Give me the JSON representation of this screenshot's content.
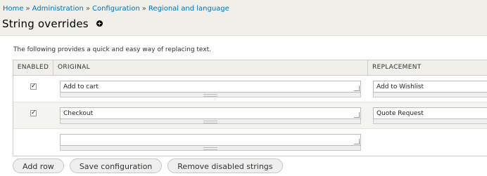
{
  "breadcrumb": {
    "items": [
      "Home",
      "Administration",
      "Configuration",
      "Regional and language"
    ],
    "separator": "»"
  },
  "page": {
    "title": "String overrides",
    "title_icon": "plus-circle-icon",
    "intro": "The following provides a quick and easy way of replacing text."
  },
  "table": {
    "headers": {
      "enabled": "ENABLED",
      "original": "ORIGINAL",
      "replacement": "REPLACEMENT"
    },
    "rows": [
      {
        "enabled": true,
        "original": "Add to cart",
        "replacement": "Add to Wishlist"
      },
      {
        "enabled": true,
        "original": "Checkout",
        "replacement": "Quote Request"
      },
      {
        "enabled": false,
        "original": "",
        "replacement": ""
      }
    ]
  },
  "actions": {
    "add_row": "Add row",
    "save": "Save configuration",
    "remove_disabled": "Remove disabled strings"
  }
}
